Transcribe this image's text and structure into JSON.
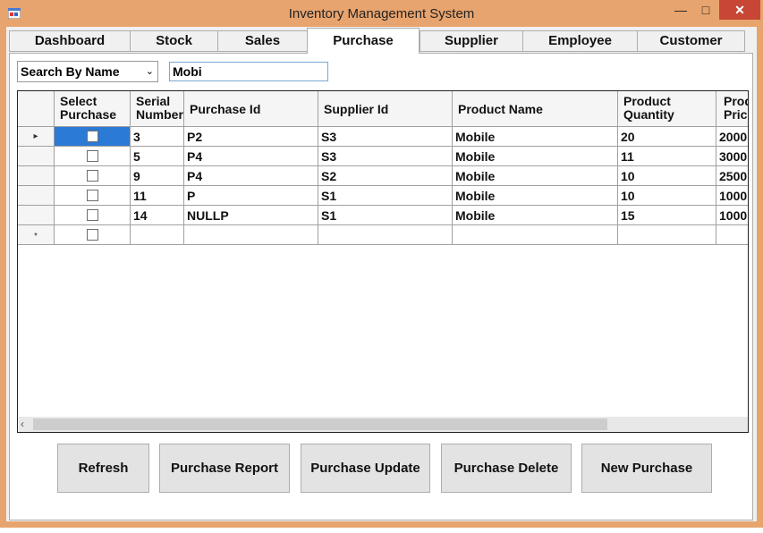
{
  "window": {
    "title": "Inventory Management System",
    "minimize_glyph": "—",
    "maximize_glyph": "□",
    "close_glyph": "✕"
  },
  "tabs": [
    "Dashboard",
    "Stock",
    "Sales",
    "Purchase",
    "Supplier",
    "Employee",
    "Customer"
  ],
  "active_tab": "Purchase",
  "search": {
    "mode": "Search By Name",
    "value": "Mobi"
  },
  "table": {
    "columns": [
      "Select Purchase",
      "Serial Number",
      "Purchase Id",
      "Supplier Id",
      "Product Name",
      "Product Quantity",
      "Product Price"
    ],
    "rows": [
      {
        "serial": "3",
        "purchase_id": "P2",
        "supplier_id": "S3",
        "product": "Mobile",
        "qty": "20",
        "price": "2000"
      },
      {
        "serial": "5",
        "purchase_id": "P4",
        "supplier_id": "S3",
        "product": "Mobile",
        "qty": "11",
        "price": "3000"
      },
      {
        "serial": "9",
        "purchase_id": "P4",
        "supplier_id": "S2",
        "product": "Mobile",
        "qty": "10",
        "price": "2500"
      },
      {
        "serial": "11",
        "purchase_id": "P",
        "supplier_id": "S1",
        "product": "Mobile",
        "qty": "10",
        "price": "1000"
      },
      {
        "serial": "14",
        "purchase_id": "NULLP",
        "supplier_id": "S1",
        "product": "Mobile",
        "qty": "15",
        "price": "1000"
      }
    ],
    "current_row_glyph": "▸",
    "new_row_glyph": "*"
  },
  "buttons": {
    "refresh": "Refresh",
    "report": "Purchase Report",
    "update": "Purchase Update",
    "delete": "Purchase Delete",
    "new": "New Purchase"
  },
  "colors": {
    "frame": "#e8a46e",
    "selection": "#2a7ad6",
    "close_button": "#c74636"
  }
}
